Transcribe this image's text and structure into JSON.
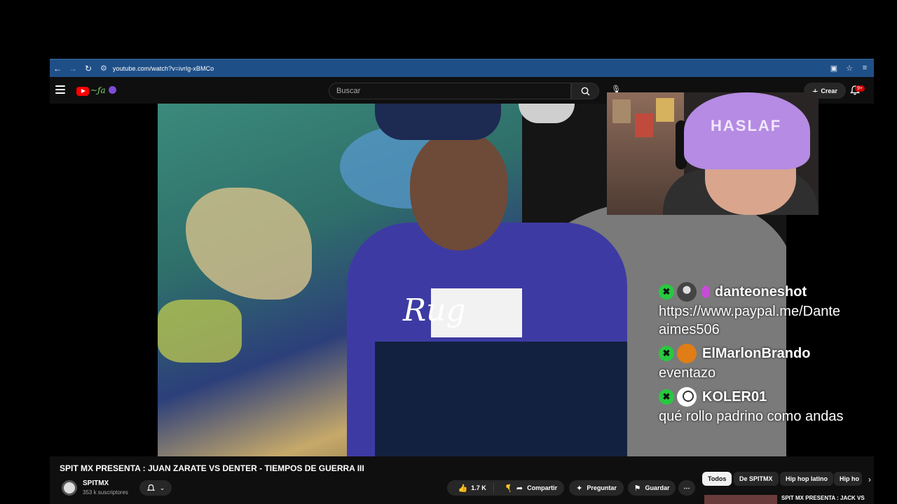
{
  "browser": {
    "url": "youtube.com/watch?v=ivrlg-xBMCo"
  },
  "header": {
    "search_placeholder": "Buscar",
    "create_label": "Crear",
    "notification_count": "9+"
  },
  "overlay": {
    "webcam_hat_text": "HASLAF",
    "hoodie_text": "Rug"
  },
  "chat": {
    "messages": [
      {
        "user": "danteoneshot",
        "text_line1": "https://www.paypal.me/Dante",
        "text_line2": "aimes506"
      },
      {
        "user": "ElMarlonBrando",
        "text_line1": "eventazo"
      },
      {
        "user": "KOLER01",
        "text_line1": "qué rollo padrino como andas"
      }
    ]
  },
  "video": {
    "title": "SPIT MX PRESENTA : JUAN ZARATE VS DENTER - TIEMPOS DE GUERRA III",
    "channel_name": "SPITMX",
    "subscribers": "353 k suscriptores",
    "likes": "1.7 K",
    "share_label": "Compartir",
    "ask_label": "Preguntar",
    "save_label": "Guardar"
  },
  "chips": [
    "Todos",
    "De SPITMX",
    "Hip hop latino",
    "Hip ho"
  ],
  "recommendation": {
    "title": "SPIT MX PRESENTA : JACK VS"
  }
}
